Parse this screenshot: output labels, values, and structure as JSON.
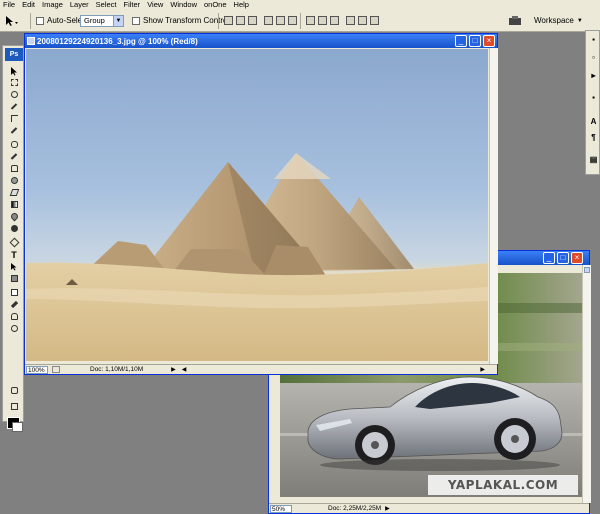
{
  "menu": [
    "File",
    "Edit",
    "Image",
    "Layer",
    "Select",
    "Filter",
    "View",
    "Window",
    "onOne",
    "Help"
  ],
  "options": {
    "auto_select_label": "Auto-Select:",
    "auto_select_value": "Group",
    "show_transform_label": "Show Transform Controls",
    "workspace_label": "Workspace"
  },
  "toolbox": {
    "logo": "Ps",
    "type_tool": "T"
  },
  "palettes": {
    "char_label": "A",
    "para_label": "¶"
  },
  "pyramids_window": {
    "title": "200801292249201​36_3.jpg @ 100% (Red/8)",
    "zoom": "100%",
    "doc_size": "Doc: 1,10M/1,10M"
  },
  "car_window": {
    "zoom": "50%",
    "doc_size": "Doc: 2,25M/2,25M"
  },
  "watermark": "YAPLAKAL.COM",
  "colors": {
    "titlebar": "#2462d8",
    "chrome": "#ece9d8",
    "workspace": "#808080",
    "close": "#e04b2a"
  }
}
